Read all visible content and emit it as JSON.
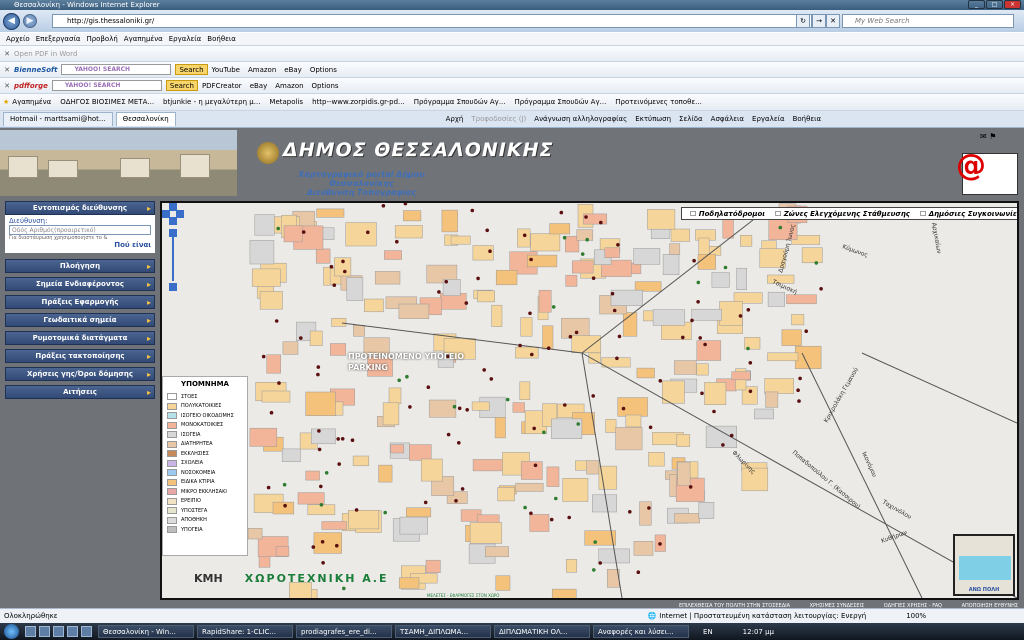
{
  "window": {
    "title": "Θεσσαλονίκη - Windows Internet Explorer"
  },
  "address": {
    "url": "http://gis.thessaloniki.gr/",
    "search_placeholder": "My Web Search"
  },
  "menu": [
    "Αρχείο",
    "Επεξεργασία",
    "Προβολή",
    "Αγαπημένα",
    "Εργαλεία",
    "Βοήθεια"
  ],
  "toolbar1": {
    "item": "Open PDF in Word"
  },
  "toolbar2": {
    "brand": "BienneSoft",
    "search_label": "YAHOO! SEARCH",
    "search_btn": "Search",
    "items": [
      "YouTube",
      "Amazon",
      "eBay",
      "Options"
    ]
  },
  "toolbar3": {
    "brand": "pdfforge",
    "search_label": "YAHOO! SEARCH",
    "search_btn": "Search",
    "items": [
      "PDFCreator",
      "eBay",
      "Amazon",
      "Options"
    ]
  },
  "bookmarks": [
    "Αγαπημένα",
    "ΟΔΗΓΟΣ ΒΙΟΣΙΜΕΣ ΜΕΤΑ...",
    "btjunkie - η μεγαλύτερη μ...",
    "Metapolis",
    "http--www.zorpidis.gr-pd...",
    "Πρόγραμμα Σπουδών Αγ...",
    "Πρόγραμμα Σπουδών Αγ...",
    "Προτεινόμενες τοποθε..."
  ],
  "tabs": [
    {
      "label": "Hotmail - marttsami@hot..."
    },
    {
      "label": "Θεσσαλονίκη"
    }
  ],
  "tab_tools": [
    "Αρχή",
    "Τροφοδοσίες (J)",
    "Ανάγνωση αλληλογραφίας",
    "Εκτύπωση",
    "Σελίδα",
    "Ασφάλεια",
    "Εργαλεία",
    "Βοήθεια"
  ],
  "banner": {
    "title": "ΔΗΜΟΣ ΘΕΣΣΑΛΟΝΙΚΗΣ",
    "subtitle1": "Χαρτογραφικό portal Δήμου Θεσσαλονίκης",
    "subtitle2": "Διεύθυνση Τοπογραφίας"
  },
  "sidebar": {
    "search_header": "Εντοπισμός διεύθυνσης",
    "address_label": "Διεύθυνση:",
    "address_placeholder": "Οδός Αριθμός(προαιρετικό)",
    "address_hint": "Για διαστάυρωση χρησιμοποιήστε το &",
    "go_label": "Πού είναι",
    "menu": [
      "Πλοήγηση",
      "Σημεία Ενδιαφέροντος",
      "Πράξεις Εφαρμογής",
      "Γεωδαιτικά σημεία",
      "Ρυμοτομικά διατάγματα",
      "Πράξεις τακτοποίησης",
      "Χρήσεις γης/Όροι δόμησης",
      "Αιτήσεις"
    ]
  },
  "map": {
    "layers": [
      "Ποδηλατόδρομοι",
      "Ζώνες Ελεγχόμενης Στάθμευσης",
      "Δημόσιες Συγκοινωνίες"
    ],
    "proposed": [
      "ΠΡΟΤΕΙΝΟΜΕΝΟ ΥΠΟΓΕΙΟ",
      "PARKING"
    ],
    "legend_title": "ΥΠΟΜΝΗΜΑ",
    "legend": [
      {
        "label": "ΣΤΟΕΣ",
        "color": "#ffffff"
      },
      {
        "label": "ΠΟΛΥΚΑΤΟΙΚΙΕΣ",
        "color": "#f6d59a"
      },
      {
        "label": "ΙΣΟΓΕΙΟ ΟΙΚΟΔΟΜΗΣ",
        "color": "#b6e0ea"
      },
      {
        "label": "ΜΟΝΟΚΑΤΟΙΚΙΕΣ",
        "color": "#f2b59a"
      },
      {
        "label": "ΙΣΟΓΕΙΑ",
        "color": "#d7d7d7"
      },
      {
        "label": "ΔΙΑΤΗΡΗΤΕΑ",
        "color": "#e7c7a6"
      },
      {
        "label": "ΕΚΚΛΗΣΙΕΣ",
        "color": "#c48a5a"
      },
      {
        "label": "ΣΧΟΛΕΙΑ",
        "color": "#c9b6e6"
      },
      {
        "label": "ΝΟΣΟΚΟΜΕΙΑ",
        "color": "#9cc9f0"
      },
      {
        "label": "ΕΙΔΙΚΑ ΚΤΙΡΙΑ",
        "color": "#f4c27a"
      },
      {
        "label": "ΜΙΚΡΟ ΕΚΚΛΗΣΑΚΙ",
        "color": "#e9a6a6"
      },
      {
        "label": "ΕΡΕΙΠΙΟ",
        "color": "#f0e3c3"
      },
      {
        "label": "ΥΠΟΣΤΕΓΑ",
        "color": "#e6e6cf"
      },
      {
        "label": "ΑΠΟΘΗΚΗ",
        "color": "#dcdcdc"
      },
      {
        "label": "ΥΠΟΓΕΙΑ",
        "color": "#bdbdbd"
      }
    ],
    "streets": [
      "Δραγούμη Ίωνος",
      "Κύμωνος",
      "Τσιμισκή",
      "Φλωρίνης",
      "Ποπαδοπούλου Γ. (Κασσιρου)",
      "Κρικρολάκη Γεμανού",
      "Ικονόμου",
      "Ταχυνόλου",
      "Κυθήρων",
      "Αρχικαίων"
    ],
    "minimap_label": "ΑΝΩ ΠΟΛΗ",
    "footer_logo1": "ΚΜΗ",
    "footer_logo2": "ΧΩΡΟΤΕΧΝΙΚΗ Α.Ε",
    "footer_logo2_sub": "ΜΕΛΕΤΕΣ - ΕΦΑΡΜΟΓΕΣ ΣΤΟΝ ΧΩΡΟ"
  },
  "page_footer": [
    "ΕΠΙΛΕΧΘΕΙΣΑ ΤΟΥ ΠΟΛΙΤΗ ΣΤΗΝ ΣΤΟΣΕΕΔΙΑ",
    "ΧΡΗΣΙΜΕΣ ΣΥΝΔΕΣΕΙΣ",
    "ΟΔΗΓΙΕΣ ΧΡΗΣΗΣ - FAQ",
    "ΑΠΟΠΟΙΗΣΗ ΕΥΘΥΝΗΣ"
  ],
  "status": {
    "left": "Ολοκληρώθηκε",
    "zone": "Internet | Προστατευμένη κατάσταση λειτουργίας: Ενεργή",
    "zoom": "100%"
  },
  "taskbar": {
    "buttons": [
      "Θεσσαλονίκη - Win...",
      "RapidShare: 1-CLIC...",
      "prodiagrafes_ere_di...",
      "ΤΣΑΜΗ_ΔΙΠΛΩΜΑ...",
      "ΔΙΠΛΩΜΑΤΙΚΗ ΟΛ...",
      "Αναφορές και λύσει..."
    ],
    "lang": "EN",
    "clock": "12:07 μμ"
  }
}
